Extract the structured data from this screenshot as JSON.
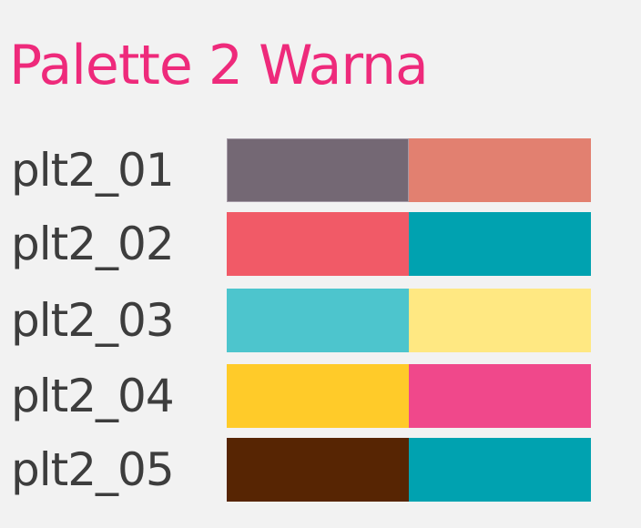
{
  "title": "Palette 2 Warna",
  "palettes": [
    {
      "name": "plt2_01",
      "colors": [
        "#746874",
        "#e28070"
      ]
    },
    {
      "name": "plt2_02",
      "colors": [
        "#f15a67",
        "#00a2b0"
      ]
    },
    {
      "name": "plt2_03",
      "colors": [
        "#4dc5cd",
        "#ffe882"
      ]
    },
    {
      "name": "plt2_04",
      "colors": [
        "#ffcb29",
        "#f0488b"
      ]
    },
    {
      "name": "plt2_05",
      "colors": [
        "#572503",
        "#00a2b0"
      ]
    }
  ]
}
